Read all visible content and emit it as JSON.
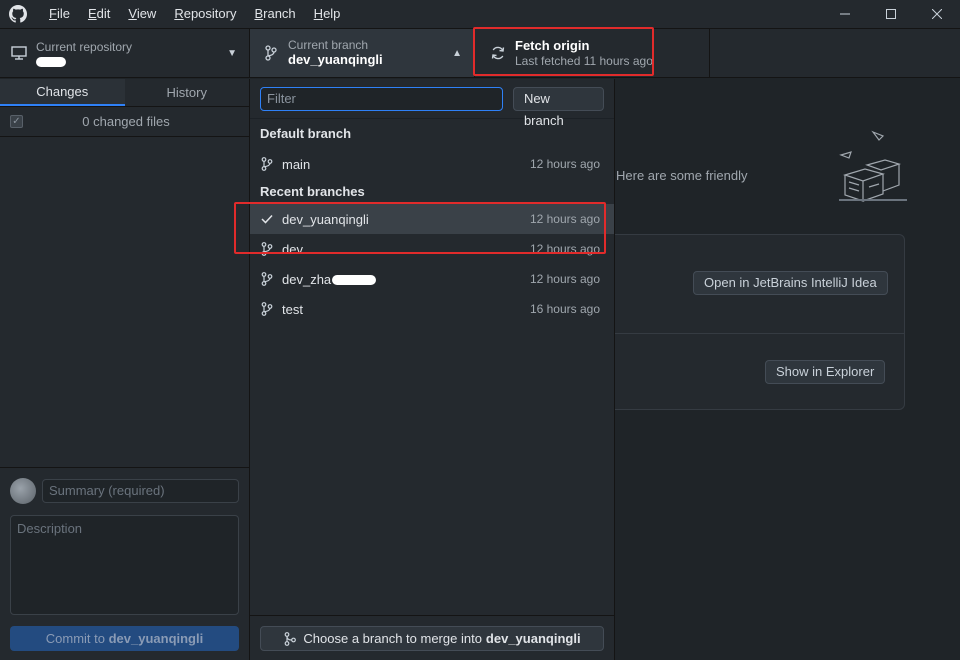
{
  "menu": [
    {
      "pre": "",
      "u": "F",
      "post": "ile"
    },
    {
      "pre": "",
      "u": "E",
      "post": "dit"
    },
    {
      "pre": "",
      "u": "V",
      "post": "iew"
    },
    {
      "pre": "",
      "u": "R",
      "post": "epository"
    },
    {
      "pre": "",
      "u": "B",
      "post": "ranch"
    },
    {
      "pre": "",
      "u": "H",
      "post": "elp"
    }
  ],
  "toolbar": {
    "repo_label": "Current repository",
    "branch_label": "Current branch",
    "branch_value": "dev_yuanqingli",
    "fetch_title": "Fetch origin",
    "fetch_sub": "Last fetched 11 hours ago"
  },
  "sidebar": {
    "tab_changes": "Changes",
    "tab_history": "History",
    "changed_files": "0 changed files",
    "summary_placeholder": "Summary (required)",
    "description_placeholder": "Description",
    "commit_prefix": "Commit to ",
    "commit_branch": "dev_yuanqingli"
  },
  "dropdown": {
    "filter_placeholder": "Filter",
    "new_branch": "New branch",
    "default_group": "Default branch",
    "recent_group": "Recent branches",
    "default_branches": [
      {
        "name": "main",
        "time": "12 hours ago"
      }
    ],
    "recent_branches": [
      {
        "name": "dev_yuanqingli",
        "time": "12 hours ago",
        "selected": true
      },
      {
        "name": "dev",
        "time": "12 hours ago"
      },
      {
        "name": "dev_zha",
        "time": "12 hours ago",
        "redacted": true
      },
      {
        "name": "test",
        "time": "16 hours ago"
      }
    ],
    "merge_prefix": "Choose a branch to merge into",
    "merge_branch": "dev_yuanqingli"
  },
  "main": {
    "friendly_text": "Here are some friendly",
    "open_editor": "Open in JetBrains IntelliJ Idea",
    "show_explorer": "Show in Explorer"
  },
  "colors": {
    "accent": "#2f81f7",
    "highlight": "#e12b2b"
  }
}
